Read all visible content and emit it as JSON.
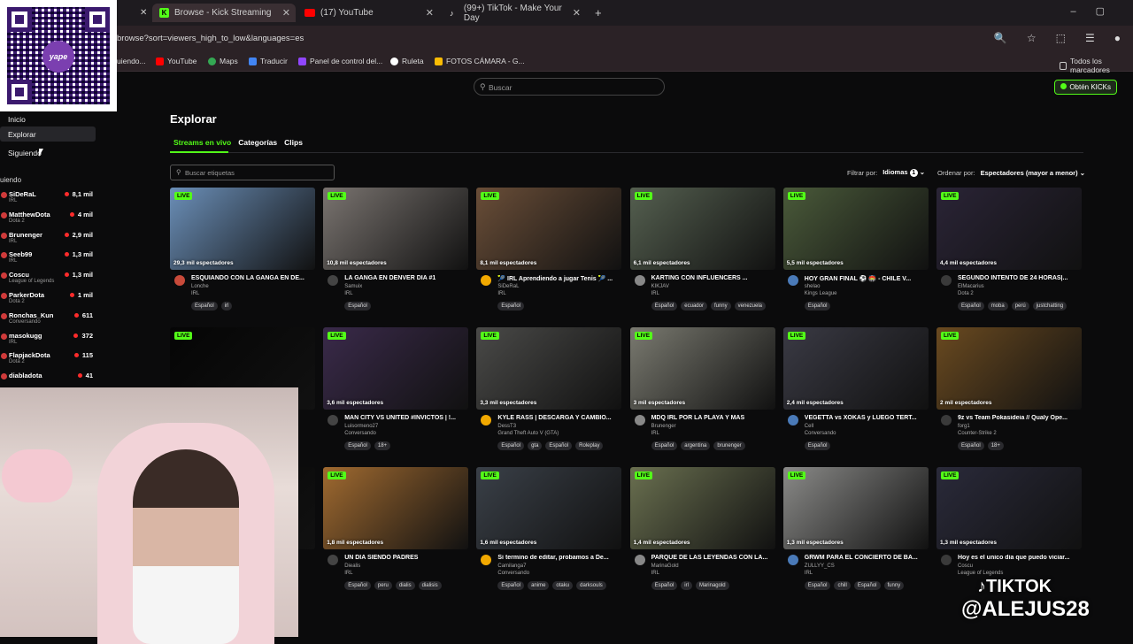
{
  "browser": {
    "tabs": [
      {
        "label": "Browse - Kick Streaming",
        "active": true
      },
      {
        "label": "(17) YouTube",
        "active": false
      },
      {
        "label": "(99+) TikTok - Make Your Day",
        "active": false
      }
    ],
    "new_tab": "+",
    "url": "browse?sort=viewers_high_to_low&languages=es",
    "bookmarks": [
      "uiendo...",
      "YouTube",
      "Maps",
      "Traducir",
      "Panel de control del...",
      "Ruleta",
      "FOTOS CÁMARA - G...",
      "Todos los marcadores"
    ]
  },
  "qr": {
    "brand": "yape"
  },
  "kick": {
    "search_placeholder": "Buscar",
    "kicks_button": "Obtén KICKs"
  },
  "sidebar": {
    "nav": [
      {
        "label": "Inicio"
      },
      {
        "label": "Explorar"
      },
      {
        "label": "Siguiendo"
      }
    ],
    "following_title": "uiendo",
    "channels": [
      {
        "name": "SiDeRaL",
        "category": "IRL",
        "viewers": "8,1 mil"
      },
      {
        "name": "MatthewDota",
        "category": "Dota 2",
        "viewers": "4 mil"
      },
      {
        "name": "Brunenger",
        "category": "IRL",
        "viewers": "2,9 mil"
      },
      {
        "name": "Seeb99",
        "category": "IRL",
        "viewers": "1,3 mil"
      },
      {
        "name": "Coscu",
        "category": "League of Legends",
        "viewers": "1,3 mil"
      },
      {
        "name": "ParkerDota",
        "category": "Dota 2",
        "viewers": "1 mil"
      },
      {
        "name": "Ronchas_Kun",
        "category": "Conversando",
        "viewers": "611"
      },
      {
        "name": "masokugg",
        "category": "IRL",
        "viewers": "372"
      },
      {
        "name": "FlapjackDota",
        "category": "Dota 2",
        "viewers": "115"
      },
      {
        "name": "diabladota",
        "category": "",
        "viewers": "41"
      }
    ]
  },
  "main": {
    "title": "Explorar",
    "tabs": [
      "Streams en vivo",
      "Categorías",
      "Clips"
    ],
    "tag_search_placeholder": "Buscar etiquetas",
    "filter_label": "Filtrar por:",
    "filter_value": "Idiomas",
    "filter_count": "1",
    "order_label": "Ordenar por:",
    "order_value": "Espectadores (mayor a menor)",
    "live_label": "LIVE"
  },
  "cards": [
    {
      "viewers": "29,3 mil espectadores",
      "title": "ESQUIANDO CON LA GANGA EN DE...",
      "channel": "Lonche",
      "category": "IRL",
      "tags": [
        "Español",
        "irl"
      ],
      "color": "#6b8fb8"
    },
    {
      "viewers": "10,8 mil espectadores",
      "title": "LA GANGA EN DENVER DIA #1",
      "channel": "Samuix",
      "category": "IRL",
      "tags": [
        "Español"
      ],
      "color": "#7a7470"
    },
    {
      "viewers": "8,1 mil espectadores",
      "title": "🎾 IRL Aprendiendo a jugar Tenis 🎾 ...",
      "channel": "SiDeRaL",
      "category": "IRL",
      "tags": [
        "Español"
      ],
      "color": "#6a4e38"
    },
    {
      "viewers": "6,1 mil espectadores",
      "title": "KARTING CON INFLUENCERS ...",
      "channel": "KIKJAV",
      "category": "IRL",
      "tags": [
        "Español",
        "ecuador",
        "funny",
        "venezuela"
      ],
      "color": "#556050"
    },
    {
      "viewers": "5,5 mil espectadores",
      "title": "HOY GRAN FINAL ⚽ 🏟️ - CHILE V...",
      "channel": "shelao",
      "category": "Kings League",
      "tags": [
        "Español"
      ],
      "color": "#4a5a3a"
    },
    {
      "viewers": "4,4 mil espectadores",
      "title": "SEGUNDO INTENTO DE 24 HORAS|...",
      "channel": "ElMacarius",
      "category": "Dota 2",
      "tags": [
        "Español",
        "moba",
        "perú",
        "justchatting"
      ],
      "color": "#2a2436"
    },
    {
      "viewers": "",
      "title": "",
      "channel": "",
      "category": "",
      "tags": [],
      "color": "#050505"
    },
    {
      "viewers": "3,6 mil espectadores",
      "title": "MAN CITY VS UNITED #INVICTOS | !...",
      "channel": "Luisormeno27",
      "category": "Conversando",
      "tags": [
        "Español",
        "18+"
      ],
      "color": "#3a2a4a"
    },
    {
      "viewers": "3,3 mil espectadores",
      "title": "KYLE RASS | DESCARGA Y CAMBIO...",
      "channel": "DessT3",
      "category": "Grand Theft Auto V (GTA)",
      "tags": [
        "Español",
        "gta",
        "Español",
        "Roleplay"
      ],
      "color": "#4a4a48"
    },
    {
      "viewers": "3 mil espectadores",
      "title": "MDQ IRL POR LA PLAYA Y MÁS",
      "channel": "Brunenger",
      "category": "IRL",
      "tags": [
        "Español",
        "argentina",
        "brunenger"
      ],
      "color": "#7a7a70"
    },
    {
      "viewers": "2,4 mil espectadores",
      "title": "VEGETTA vs XOKAS y LUEGO TERT...",
      "channel": "Cell",
      "category": "Conversando",
      "tags": [
        "Español"
      ],
      "color": "#3a3a44"
    },
    {
      "viewers": "2 mil espectadores",
      "title": "9z vs Team Pokasideia // Qualy Ope...",
      "channel": "forg1",
      "category": "Counter-Strike 2",
      "tags": [
        "Español",
        "18+"
      ],
      "color": "#6a4a20"
    },
    {
      "viewers": "",
      "title": "",
      "channel": "",
      "category": "",
      "tags": [],
      "color": "#050505"
    },
    {
      "viewers": "1,8 mil espectadores",
      "title": "UN DÍA SIENDO PADRES",
      "channel": "Diealis",
      "category": "IRL",
      "tags": [
        "Español",
        "peru",
        "dialis",
        "dialisis"
      ],
      "color": "#a06a30"
    },
    {
      "viewers": "1,6 mil espectadores",
      "title": "Si termino de editar, probamos a De...",
      "channel": "Camilanga7",
      "category": "Conversando",
      "tags": [
        "Español",
        "anime",
        "otaku",
        "darksouls"
      ],
      "color": "#3a4048"
    },
    {
      "viewers": "1,4 mil espectadores",
      "title": "PARQUE DE LAS LEYENDAS CON LA...",
      "channel": "MarinaGold",
      "category": "IRL",
      "tags": [
        "Español",
        "irl",
        "Marinagold"
      ],
      "color": "#6a7050"
    },
    {
      "viewers": "1,3 mil espectadores",
      "title": "GRWM PARA EL CONCIERTO DE BA...",
      "channel": "ZULLYY_CS",
      "category": "IRL",
      "tags": [
        "Español",
        "chill",
        "Español",
        "funny"
      ],
      "color": "#8a8a88"
    },
    {
      "viewers": "1,3 mil espectadores",
      "title": "Hoy es el unico dia que puedo viciar...",
      "channel": "Coscu",
      "category": "League of Legends",
      "tags": [],
      "color": "#2a2a3a"
    }
  ],
  "watermark": {
    "line1": "TIKTOK",
    "line2": "@ALEJUS28"
  }
}
